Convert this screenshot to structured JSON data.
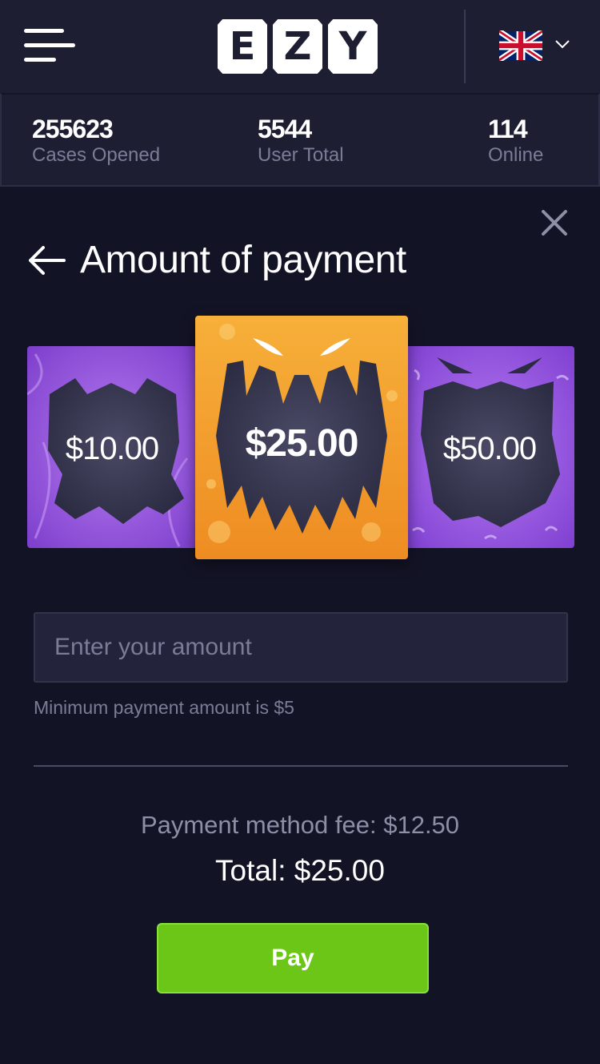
{
  "header": {
    "logo_letters": [
      "E",
      "Z",
      "Y"
    ],
    "logo_text": "EZY",
    "language": "en-GB",
    "flag_icon": "uk-flag-icon"
  },
  "stats": [
    {
      "value": "255623",
      "label": "Cases Opened"
    },
    {
      "value": "5544",
      "label": "User Total"
    },
    {
      "value": "114",
      "label": "Online"
    }
  ],
  "modal": {
    "title": "Amount of payment",
    "close_label": "X"
  },
  "cards": [
    {
      "amount": "$10.00",
      "selected": false,
      "color": "#9a5ce0"
    },
    {
      "amount": "$25.00",
      "selected": true,
      "color": "#f0952a"
    },
    {
      "amount": "$50.00",
      "selected": false,
      "color": "#9a5ce0"
    }
  ],
  "amount_input": {
    "value": "",
    "placeholder": "Enter your amount"
  },
  "min_note": "Minimum payment amount is $5",
  "fee_text": "Payment method fee: $12.50",
  "total_text": "Total: $25.00",
  "pay_label": "Pay",
  "colors": {
    "background": "#131326",
    "panel": "#1e1e33",
    "accent_green": "#6cc617",
    "accent_orange": "#f0952a",
    "accent_purple": "#9a5ce0"
  }
}
